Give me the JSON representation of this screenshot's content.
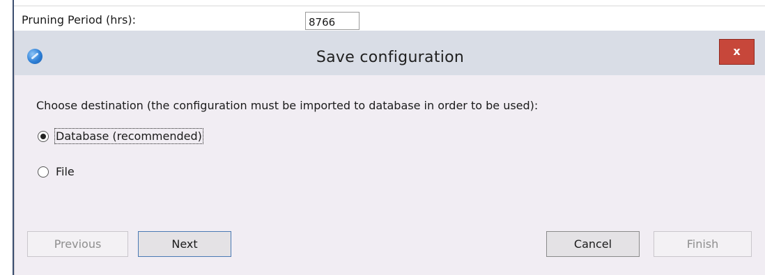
{
  "background_form": {
    "pruning_label": "Pruning Period (hrs):",
    "pruning_value": "8766"
  },
  "dialog": {
    "title": "Save configuration",
    "close_label": "x",
    "prompt": "Choose destination (the configuration must be imported to database in order to be used):",
    "options": [
      {
        "label": "Database (recommended)",
        "selected": true
      },
      {
        "label": "File",
        "selected": false
      }
    ],
    "buttons": {
      "previous": {
        "label": "Previous",
        "enabled": false
      },
      "next": {
        "label": "Next",
        "enabled": true
      },
      "cancel": {
        "label": "Cancel",
        "enabled": true
      },
      "finish": {
        "label": "Finish",
        "enabled": false
      }
    }
  },
  "colors": {
    "dialog_background": "#f1edf3",
    "titlebar_background": "#d9dde6",
    "close_button": "#c7473a",
    "default_button_border": "#4a79b4"
  },
  "icons": {
    "app": "app-logo-icon",
    "close": "close-icon",
    "radio_selected": "radio-selected-icon",
    "radio_unselected": "radio-unselected-icon"
  }
}
